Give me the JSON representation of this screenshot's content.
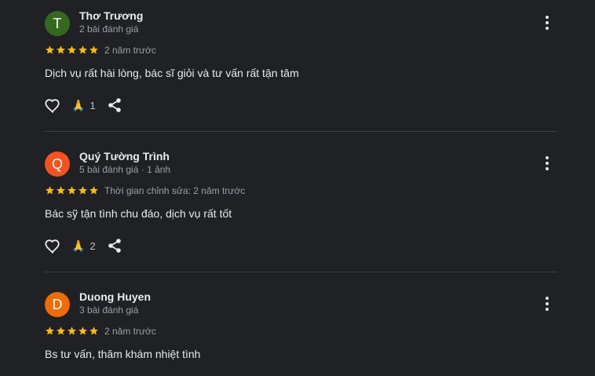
{
  "reviews": [
    {
      "avatar_letter": "T",
      "avatar_color": "#33691e",
      "name": "Thơ Trương",
      "meta": "2 bài đánh giá",
      "rating": 5,
      "time": "2 năm trước",
      "text": "Dịch vụ rất hài lòng, bác sĩ giỏi và tư vấn rất tận tâm",
      "reaction_emoji": "🙏",
      "reaction_count": "1"
    },
    {
      "avatar_letter": "Q",
      "avatar_color": "#f4511e",
      "name": "Quý Tường Trình",
      "meta": "5 bài đánh giá · 1 ảnh",
      "rating": 5,
      "time": "Thời gian chỉnh sửa: 2 năm trước",
      "text": "Bác sỹ tận tình chu đáo, dịch vụ rất tốt",
      "reaction_emoji": "🙏",
      "reaction_count": "2"
    },
    {
      "avatar_letter": "D",
      "avatar_color": "#ef6c00",
      "name": "Duong Huyen",
      "meta": "3 bài đánh giá",
      "rating": 5,
      "time": "2 năm trước",
      "text": "Bs tư vấn, thăm khám nhiệt tình"
    }
  ],
  "colors": {
    "background": "#202124",
    "star": "#fbbc04",
    "divider": "#3c4043"
  },
  "icons": {
    "like": "heart-outline-icon",
    "share": "share-icon",
    "more": "more-vertical-icon",
    "star": "star-icon"
  }
}
